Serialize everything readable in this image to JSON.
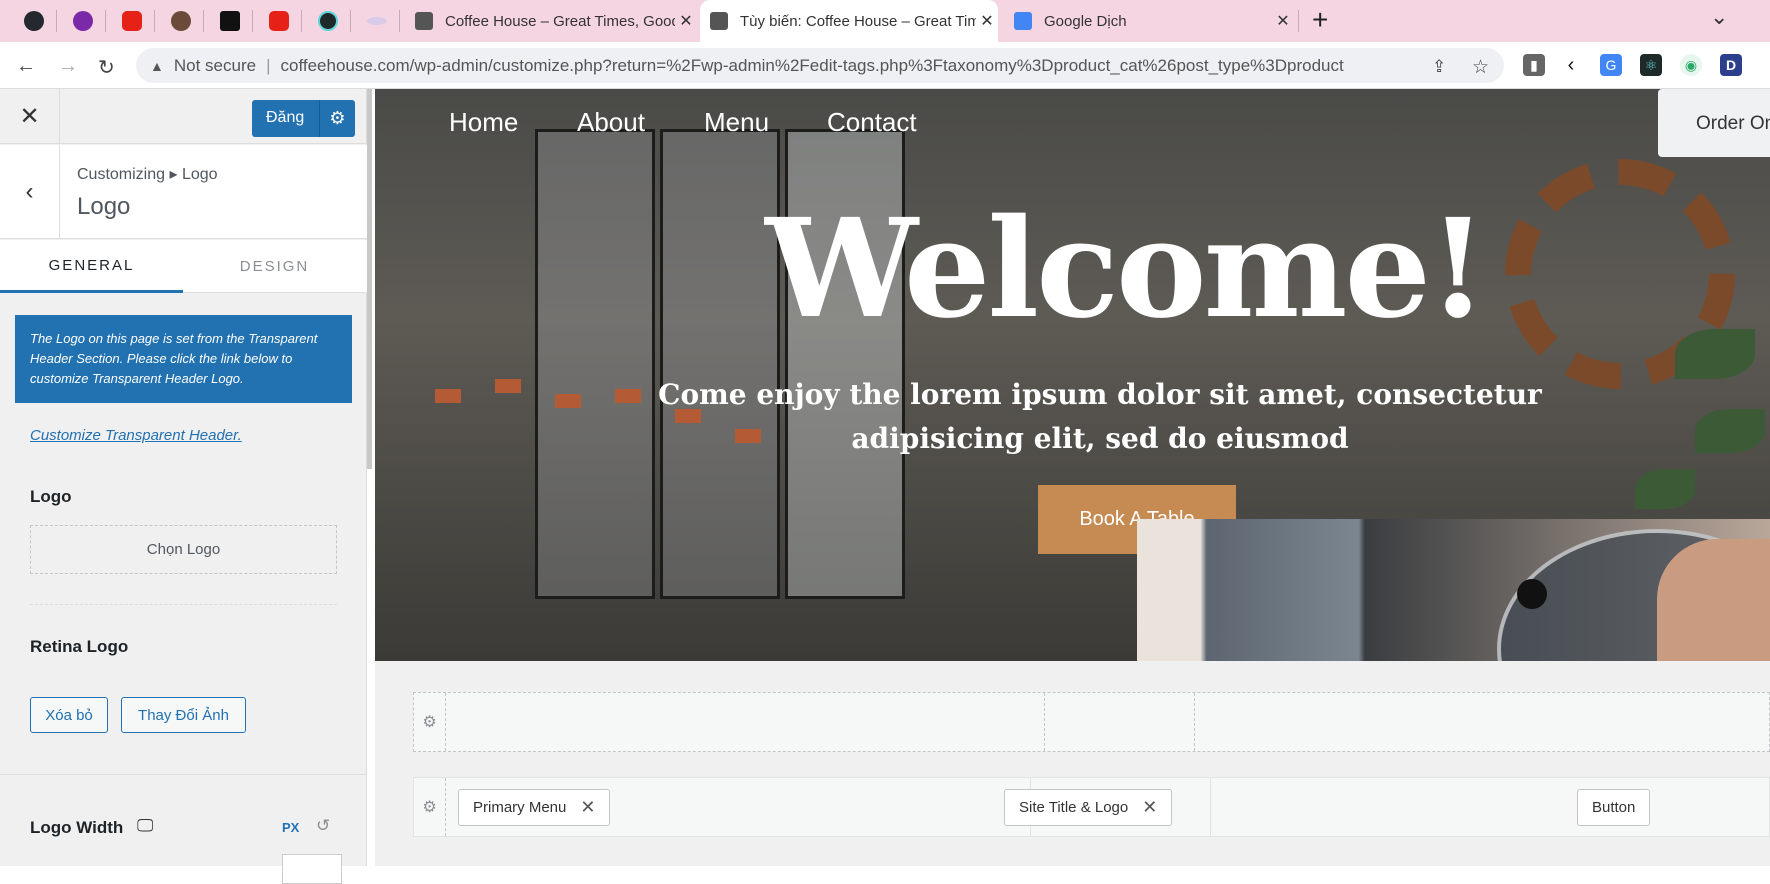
{
  "browser": {
    "tabs": [
      {
        "title": "Coffee House – Great Times, Good Coffee",
        "active": false
      },
      {
        "title": "Tùy biến: Coffee House – Great Times, Good Coffee",
        "active": true
      },
      {
        "title": "Google Dịch",
        "active": false
      }
    ],
    "new_tab": "+",
    "tab_menu": "⌄",
    "address": {
      "security": "Not secure",
      "url": "coffeehouse.com/wp-admin/customize.php?return=%2Fwp-admin%2Fedit-tags.php%3Ftaxonomy%3Dproduct_cat%26post_type%3Dproduct"
    }
  },
  "customizer": {
    "publish_label": "Đăng",
    "breadcrumb": "Customizing ▸ Logo",
    "section_title": "Logo",
    "tabs": [
      "GENERAL",
      "DESIGN"
    ],
    "notice": "The Logo on this page is set from the Transparent Header Section. Please click the link below to customize Transparent Header Logo.",
    "link": "Customize Transparent Header.",
    "logo_label": "Logo",
    "choose_logo": "Chọn Logo",
    "retina_label": "Retina Logo",
    "remove": "Xóa bỏ",
    "change_image": "Thay Đổi Ảnh",
    "logo_width_label": "Logo Width",
    "unit": "PX"
  },
  "preview": {
    "menu": [
      "Home",
      "About",
      "Menu",
      "Contact"
    ],
    "order_button": "Order Online",
    "headline": "Welcome!",
    "subheadline": "Come enjoy the lorem ipsum dolor sit amet, consectetur adipisicing elit, sed do eiusmod",
    "cta": "Book A Table",
    "builder": {
      "chips": [
        "Primary Menu",
        "Site Title & Logo",
        "Button"
      ]
    }
  },
  "colors": {
    "tabbar": "#f6d5e2",
    "wp_blue": "#2271b1",
    "cta": "#c68b52"
  }
}
